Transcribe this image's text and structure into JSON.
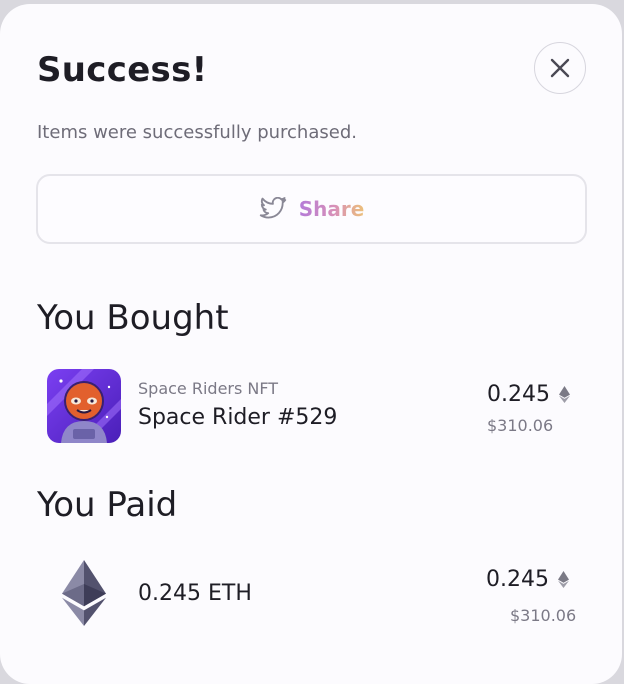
{
  "modal": {
    "title": "Success!",
    "subtitle": "Items were successfully purchased.",
    "close_icon": "close-icon"
  },
  "share": {
    "label": "Share",
    "icon": "twitter-icon",
    "gradient": [
      "#b37ad8",
      "#d890b8",
      "#ecc07a"
    ]
  },
  "bought": {
    "heading": "You Bought",
    "item": {
      "collection": "Space Riders NFT",
      "name": "Space Rider #529",
      "price": "0.245",
      "price_usd": "$310.06",
      "currency_icon": "eth-icon"
    }
  },
  "paid": {
    "heading": "You Paid",
    "token": "0.245 ETH",
    "price": "0.245",
    "price_usd": "$310.06",
    "token_icon": "ethereum-logo-icon"
  }
}
